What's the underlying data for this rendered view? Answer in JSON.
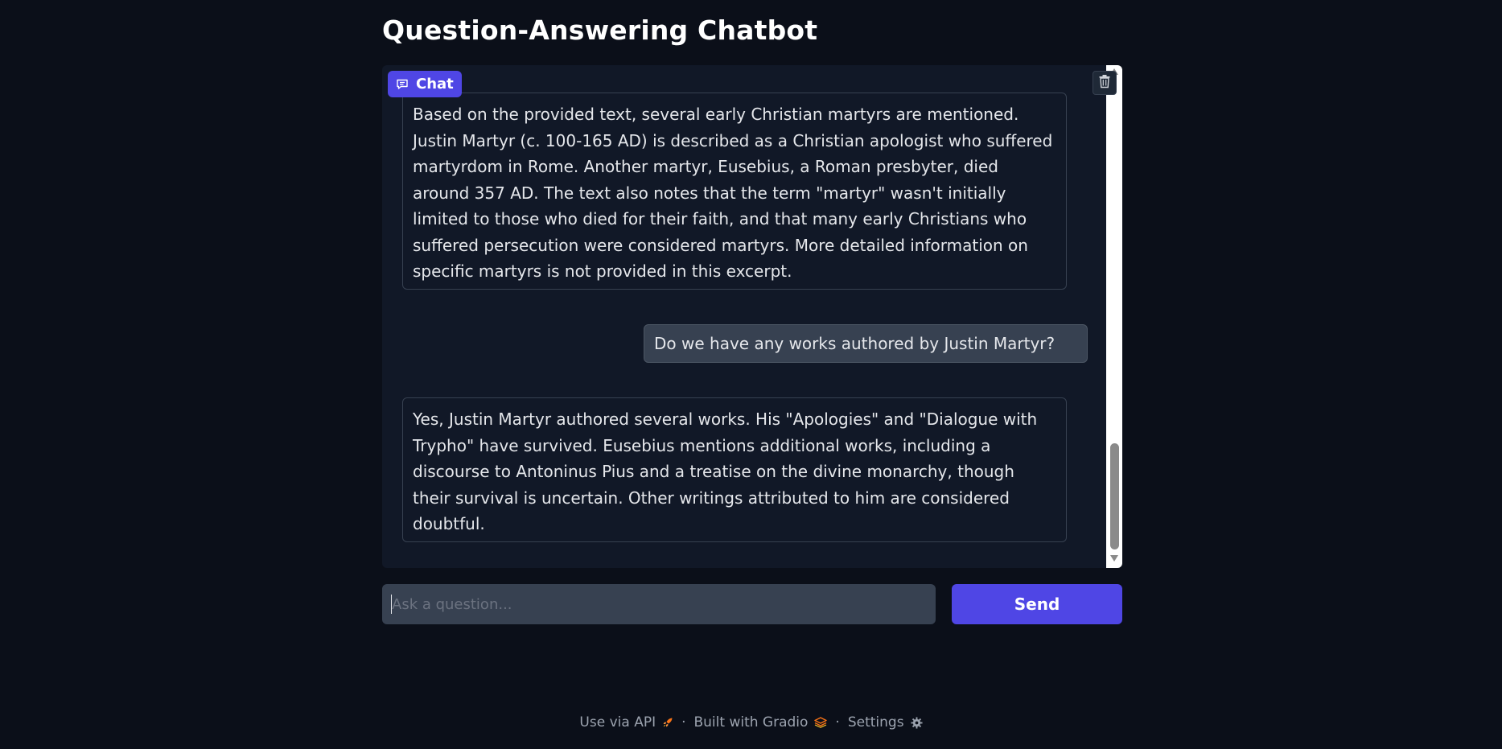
{
  "page": {
    "title": "Question-Answering Chatbot"
  },
  "chatbot": {
    "label": "Chat",
    "icons": {
      "label": "chat-bubble-icon",
      "clear": "trash-icon"
    },
    "messages": [
      {
        "role": "bot",
        "text": "Based on the provided text, several early Christian martyrs are mentioned. Justin Martyr (c. 100-165 AD) is described as a Christian apologist who suffered martyrdom in Rome. Another martyr, Eusebius, a Roman presbyter, died around 357 AD. The text also notes that the term \"martyr\" wasn't initially limited to those who died for their faith, and that many early Christians who suffered persecution were considered martyrs. More detailed information on specific martyrs is not provided in this excerpt."
      },
      {
        "role": "user",
        "text": "Do we have any works authored by Justin Martyr?"
      },
      {
        "role": "bot",
        "text": "Yes, Justin Martyr authored several works. His \"Apologies\" and \"Dialogue with Trypho\" have survived. Eusebius mentions additional works, including a discourse to Antoninus Pius and a treatise on the divine monarchy, though their survival is uncertain. Other writings attributed to him are considered doubtful."
      }
    ]
  },
  "input": {
    "placeholder": "Ask a question...",
    "value": ""
  },
  "send_button": {
    "label": "Send"
  },
  "footer": {
    "api_label": "Use via API",
    "api_icon": "rocket-icon",
    "built_label": "Built with Gradio",
    "built_icon": "gradio-logo-icon",
    "settings_label": "Settings",
    "settings_icon": "gear-icon",
    "separator": "·"
  },
  "colors": {
    "background": "#0b0f19",
    "panel": "#111827",
    "accent": "#4f46e5",
    "user_bubble": "#374151",
    "orange": "#f97316"
  }
}
